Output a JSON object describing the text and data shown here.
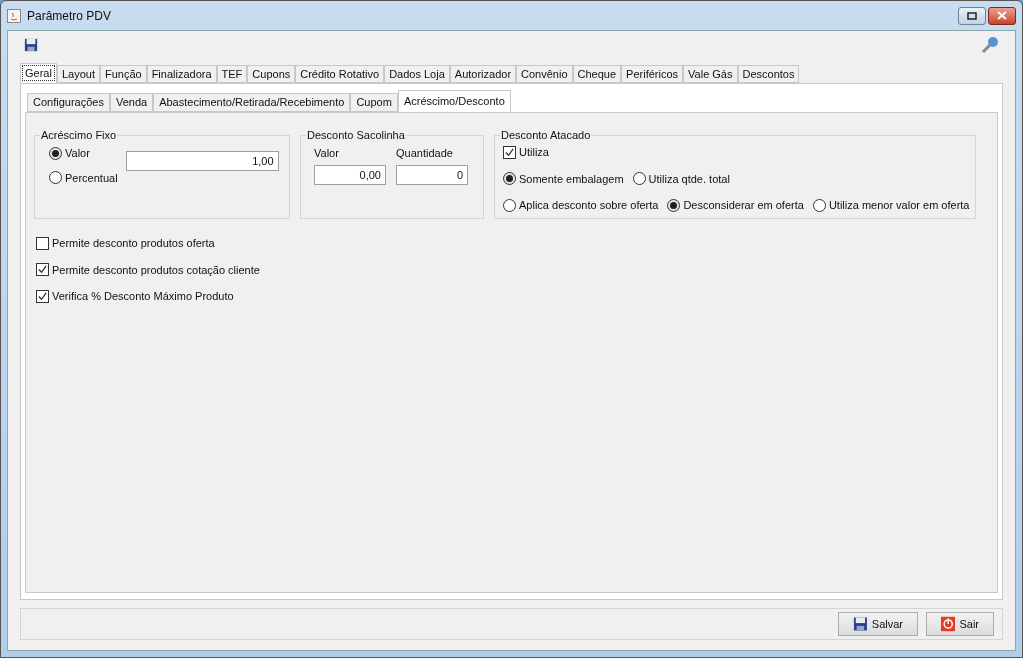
{
  "window": {
    "title": "Parâmetro PDV"
  },
  "tabs": [
    {
      "label": "Geral",
      "selected": true
    },
    {
      "label": "Layout",
      "selected": false
    },
    {
      "label": "Função",
      "selected": false
    },
    {
      "label": "Finalizadora",
      "selected": false
    },
    {
      "label": "TEF",
      "selected": false
    },
    {
      "label": "Cupons",
      "selected": false
    },
    {
      "label": "Crédito Rotativo",
      "selected": false
    },
    {
      "label": "Dados Loja",
      "selected": false
    },
    {
      "label": "Autorizador",
      "selected": false
    },
    {
      "label": "Convênio",
      "selected": false
    },
    {
      "label": "Cheque",
      "selected": false
    },
    {
      "label": "Periféricos",
      "selected": false
    },
    {
      "label": "Vale Gás",
      "selected": false
    },
    {
      "label": "Descontos",
      "selected": false
    }
  ],
  "subtabs": [
    {
      "label": "Configurações",
      "selected": false
    },
    {
      "label": "Venda",
      "selected": false
    },
    {
      "label": "Abastecimento/Retirada/Recebimento",
      "selected": false
    },
    {
      "label": "Cupom",
      "selected": false
    },
    {
      "label": "Acréscimo/Desconto",
      "selected": true
    }
  ],
  "acrescimo_fixo": {
    "title": "Acréscimo Fixo",
    "options": [
      {
        "label": "Valor",
        "selected": true
      },
      {
        "label": "Percentual",
        "selected": false
      }
    ],
    "value": "1,00"
  },
  "desconto_sacolinha": {
    "title": "Desconto Sacolinha",
    "fields": [
      {
        "label": "Valor",
        "value": "0,00"
      },
      {
        "label": "Quantidade",
        "value": "0"
      }
    ]
  },
  "desconto_atacado": {
    "title": "Desconto Atacado",
    "utiliza": {
      "label": "Utiliza",
      "checked": true
    },
    "embalagem_options": [
      {
        "label": "Somente embalagem",
        "selected": true
      },
      {
        "label": "Utiliza qtde. total",
        "selected": false
      }
    ],
    "oferta_options": [
      {
        "label": "Aplica desconto sobre oferta",
        "selected": false
      },
      {
        "label": "Desconsiderar em oferta",
        "selected": true
      },
      {
        "label": "Utiliza menor valor em oferta",
        "selected": false
      }
    ]
  },
  "checkboxes": [
    {
      "label": "Permite desconto produtos oferta",
      "checked": false
    },
    {
      "label": "Permite desconto produtos cotação cliente",
      "checked": true
    },
    {
      "label": "Verifica % Desconto Máximo Produto",
      "checked": true
    }
  ],
  "buttons": [
    {
      "label": "Salvar",
      "kind": "save"
    },
    {
      "label": "Sair",
      "kind": "exit"
    }
  ]
}
